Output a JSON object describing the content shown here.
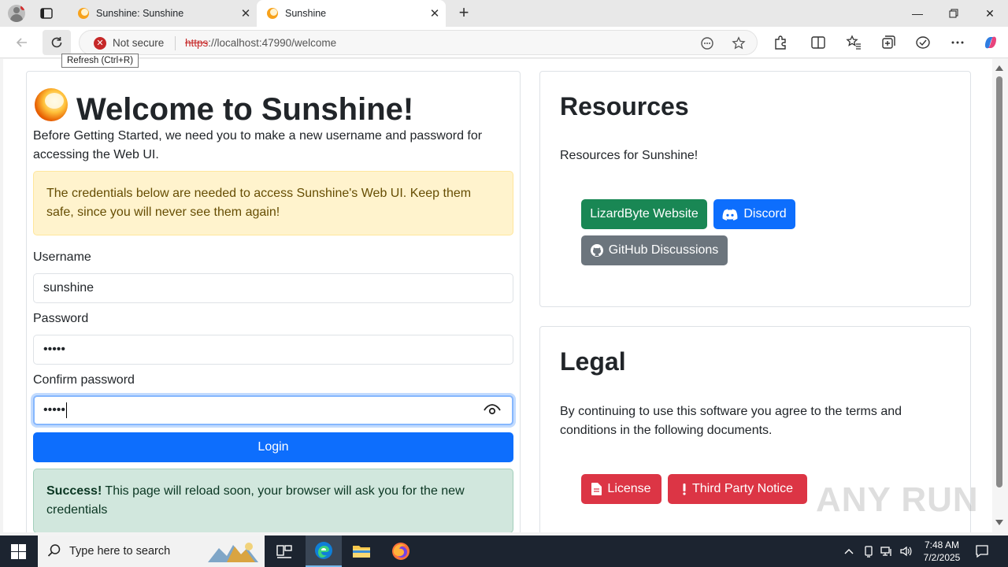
{
  "browser": {
    "tabs": [
      {
        "title": "Sunshine: Sunshine"
      },
      {
        "title": "Sunshine"
      }
    ],
    "security_label": "Not secure",
    "url_scheme": "https",
    "url_rest": "://localhost:47990/welcome",
    "tooltip": "Refresh (Ctrl+R)"
  },
  "welcome": {
    "title": "Welcome to Sunshine!",
    "intro": "Before Getting Started, we need you to make a new username and password for accessing the Web UI.",
    "warning": "The credentials below are needed to access Sunshine's Web UI. Keep them safe, since you will never see them again!",
    "username_label": "Username",
    "username_value": "sunshine",
    "password_label": "Password",
    "password_value": "•••••",
    "confirm_label": "Confirm password",
    "confirm_value": "•••••",
    "login_label": "Login",
    "success_strong": "Success!",
    "success_text": " This page will reload soon, your browser will ask you for the new credentials"
  },
  "resources": {
    "title": "Resources",
    "text": "Resources for Sunshine!",
    "buttons": {
      "website": "LizardByte Website",
      "discord": "Discord",
      "github": "GitHub Discussions"
    }
  },
  "legal": {
    "title": "Legal",
    "text": "By continuing to use this software you agree to the terms and conditions in the following documents.",
    "buttons": {
      "license": "License",
      "third_party": "Third Party Notice"
    }
  },
  "watermark": "ANY RUN",
  "taskbar": {
    "search_placeholder": "Type here to search",
    "time": "7:48 AM",
    "date": "7/2/2025"
  },
  "colors": {
    "primary": "#0d6efd",
    "success": "#198754",
    "secondary": "#6c757d",
    "danger": "#dc3545"
  }
}
